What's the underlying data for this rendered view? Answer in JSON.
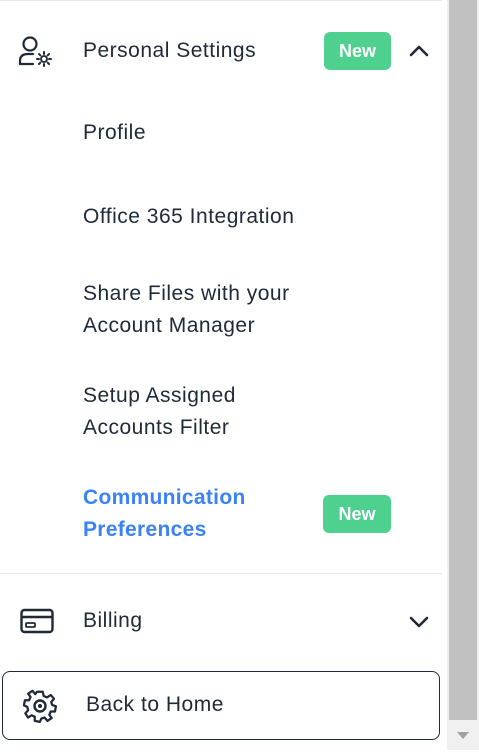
{
  "menu": {
    "personal_settings": {
      "label": "Personal Settings",
      "badge": "New",
      "icon": "user-gear-icon",
      "expanded": true,
      "chevron": "chevron-up-icon"
    },
    "sub_items": [
      {
        "label": "Profile"
      },
      {
        "label": "Office 365 Integration"
      },
      {
        "label_line1": "Share Files with your",
        "label_line2": "Account Manager"
      },
      {
        "label_line1": "Setup Assigned",
        "label_line2": "Accounts Filter"
      },
      {
        "label_line1": "Communication",
        "label_line2": "Preferences",
        "badge": "New",
        "active": true
      }
    ],
    "billing": {
      "label": "Billing",
      "icon": "credit-card-icon",
      "chevron": "chevron-down-icon"
    },
    "back_home": {
      "label": "Back to Home",
      "icon": "gear-icon"
    }
  },
  "colors": {
    "badge_green": "#4ed18f",
    "active_blue": "#3b82f6",
    "text_dark": "#1f2937"
  }
}
